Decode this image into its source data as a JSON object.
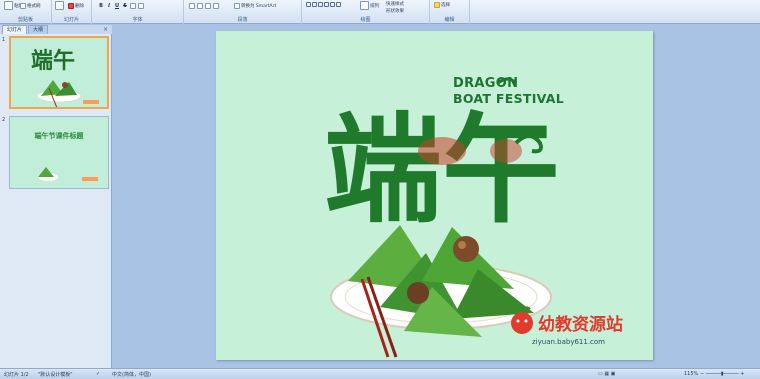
{
  "ribbon": {
    "clipboard": {
      "paste_label": "粘贴",
      "copy_label": "格式刷",
      "group_label": "剪贴板"
    },
    "slides": {
      "new_slide_label": "新建\n幻灯片",
      "delete_label": "删除",
      "group_label": "幻灯片"
    },
    "font": {
      "bold": "B",
      "italic": "I",
      "underline": "U",
      "strike": "S",
      "group_label": "字体"
    },
    "paragraph": {
      "smartart_label": "转换为 SmartArt",
      "group_label": "段落"
    },
    "drawing": {
      "arrange_label": "排列",
      "quick_styles_label": "快速样式",
      "shape_effects_label": "形状效果",
      "group_label": "绘图"
    },
    "editing": {
      "select_label": "选择",
      "group_label": "编辑"
    }
  },
  "panel": {
    "tabs": [
      "幻灯片",
      "大纲"
    ],
    "close_glyph": "×",
    "thumbnails": [
      {
        "number": "1"
      },
      {
        "number": "2",
        "title": "端午节课件标题"
      }
    ]
  },
  "slide": {
    "title_chinese": "端午",
    "title_english_line1": "DRAGON",
    "title_english_line2": "BOAT FESTIVAL",
    "logo_text": "幼教资源站",
    "logo_url": "ziyuan.baby611.com"
  },
  "status": {
    "slide_counter": "幻灯片 1/2",
    "theme": "\"默认设计模板\"",
    "language": "中文(简体，中国)",
    "zoom": "115%"
  },
  "colors": {
    "ribbon_bg": "#d3e1f3",
    "workspace_bg": "#a8c3e4",
    "slide_bg": "#c7f0d8",
    "title_green": "#1c7530",
    "title_red": "#c7402a",
    "selection_orange": "#f0a64a"
  }
}
